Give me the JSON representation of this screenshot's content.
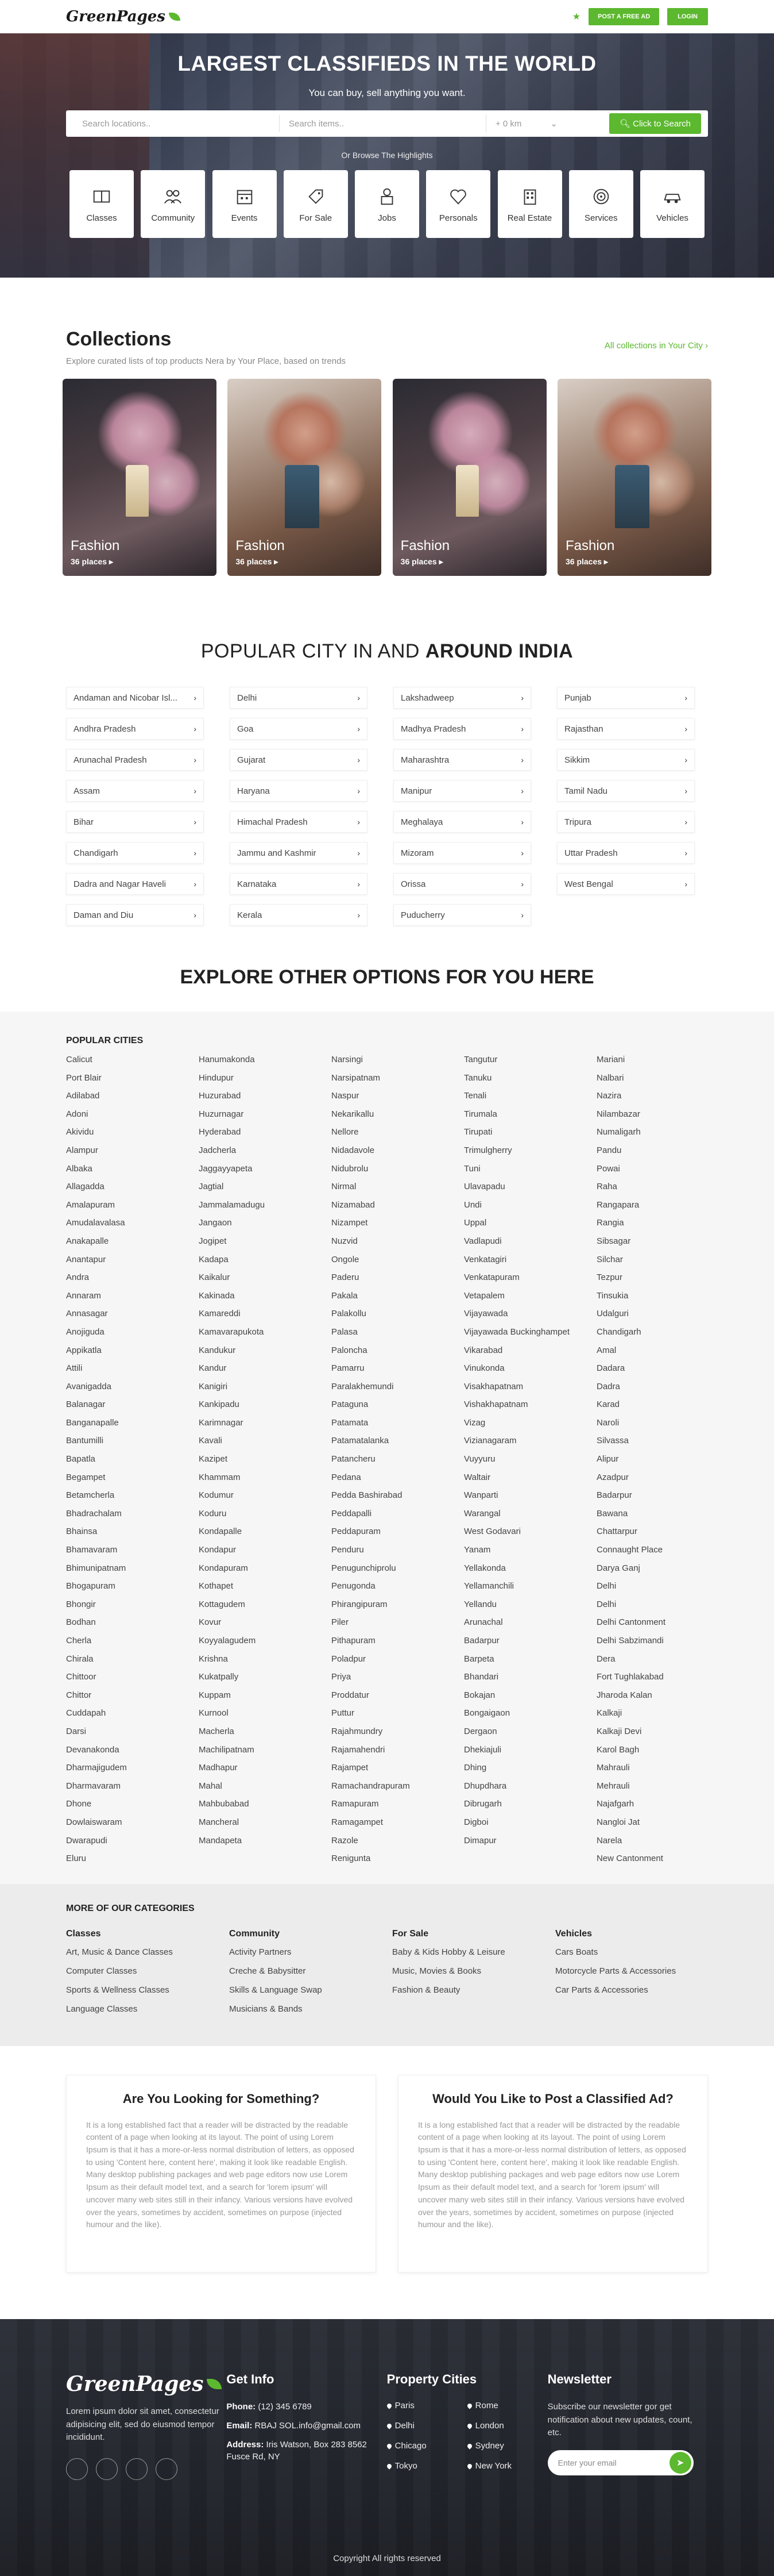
{
  "header": {
    "logo": "GreenPages",
    "post_label": "POST A FREE AD",
    "login_label": "LOGIN"
  },
  "hero": {
    "title": "LARGEST CLASSIFIEDS IN THE WORLD",
    "subtitle": "You can buy, sell anything you want.",
    "location_placeholder": "Search locations..",
    "item_placeholder": "Search items..",
    "km_value": "+ 0 km",
    "search_label": "Click to Search",
    "browse_text": "Or Browse The Highlights",
    "categories": [
      "Classes",
      "Community",
      "Events",
      "For Sale",
      "Jobs",
      "Personals",
      "Real Estate",
      "Services",
      "Vehicles"
    ]
  },
  "collections": {
    "title": "Collections",
    "desc": "Explore curated lists of top products Nera by Your Place, based on trends",
    "all_link": "All collections in Your City",
    "cards": [
      {
        "title": "Fashion",
        "places": "36 places"
      },
      {
        "title": "Fashion",
        "places": "36 places"
      },
      {
        "title": "Fashion",
        "places": "36 places"
      },
      {
        "title": "Fashion",
        "places": "36 places"
      }
    ]
  },
  "popular": {
    "title_a": "POPULAR CITY IN AND",
    "title_b": "AROUND INDIA",
    "states": [
      "Andaman and Nicobar Isl...",
      "Delhi",
      "Lakshadweep",
      "Punjab",
      "Andhra Pradesh",
      "Goa",
      "Madhya Pradesh",
      "Rajasthan",
      "Arunachal Pradesh",
      "Gujarat",
      "Maharashtra",
      "Sikkim",
      "Assam",
      "Haryana",
      "Manipur",
      "Tamil Nadu",
      "Bihar",
      "Himachal Pradesh",
      "Meghalaya",
      "Tripura",
      "Chandigarh",
      "Jammu and Kashmir",
      "Mizoram",
      "Uttar Pradesh",
      "Dadra and Nagar Haveli",
      "Karnataka",
      "Orissa",
      "West Bengal",
      "Daman and Diu",
      "Kerala",
      "Puducherry"
    ]
  },
  "explore": {
    "title": "EXPLORE OTHER OPTIONS FOR YOU HERE",
    "popular_cities_title": "POPULAR CITIES",
    "columns": [
      [
        "Calicut",
        "Port Blair",
        "Adilabad",
        "Adoni",
        "Akividu",
        "Alampur",
        "Albaka",
        "Allagadda",
        "Amalapuram",
        "Amudalavalasa",
        "Anakapalle",
        "Anantapur",
        "Andra",
        "Annaram",
        "Annasagar",
        "Anojiguda",
        "Appikatla",
        "Attili",
        "Avanigadda",
        "Balanagar",
        "Banganapalle",
        "Bantumilli",
        "Bapatla",
        "Begampet",
        "Betamcherla",
        "Bhadrachalam",
        "Bhainsa",
        "Bhamavaram",
        "Bhimunipatnam",
        "Bhogapuram",
        "Bhongir",
        "Bodhan",
        "Cherla",
        "Chirala",
        "Chittoor",
        "Chittor",
        "Cuddapah",
        "Darsi",
        "Devanakonda",
        "Dharmajigudem",
        "Dharmavaram",
        "Dhone",
        "Dowlaiswaram",
        "Dwarapudi",
        "Eluru"
      ],
      [
        "Hanumakonda",
        "Hindupur",
        "Huzurabad",
        "Huzurnagar",
        "Hyderabad",
        "Jadcherla",
        "Jaggayyapeta",
        "Jagtial",
        "Jammalamadugu",
        "Jangaon",
        "Jogipet",
        "Kadapa",
        "Kaikalur",
        "Kakinada",
        "Kamareddi",
        "Kamavarapukota",
        "Kandukur",
        "Kandur",
        "Kanigiri",
        "Kankipadu",
        "Karimnagar",
        "Kavali",
        "Kazipet",
        "Khammam",
        "Kodumur",
        "Koduru",
        "Kondapalle",
        "Kondapur",
        "Kondapuram",
        "Kothapet",
        "Kottagudem",
        "Kovur",
        "Koyyalagudem",
        "Krishna",
        "Kukatpally",
        "Kuppam",
        "Kurnool",
        "Macherla",
        "Machilipatnam",
        "Madhapur",
        "Mahal",
        "Mahbubabad",
        "Mancheral",
        "Mandapeta"
      ],
      [
        "Narsingi",
        "Narsipatnam",
        "Naspur",
        "Nekarikallu",
        "Nellore",
        "Nidadavole",
        "Nidubrolu",
        "Nirmal",
        "Nizamabad",
        "Nizampet",
        "Nuzvid",
        "Ongole",
        "Paderu",
        "Pakala",
        "Palakollu",
        "Palasa",
        "Paloncha",
        "Pamarru",
        "Paralakhemundi",
        "Pataguna",
        "Patamata",
        "Patamatalanka",
        "Patancheru",
        "Pedana",
        "Pedda Bashirabad",
        "Peddapalli",
        "Peddapuram",
        "Penduru",
        "Penugunchiprolu",
        "Penugonda",
        "Phirangipuram",
        "Piler",
        "Pithapuram",
        "Poladpur",
        "Priya",
        "Proddatur",
        "Puttur",
        "Rajahmundry",
        "Rajamahendri",
        "Rajampet",
        "Ramachandrapuram",
        "Ramapuram",
        "Ramagampet",
        "Razole",
        "Renigunta"
      ],
      [
        "Tangutur",
        "Tanuku",
        "Tenali",
        "Tirumala",
        "Tirupati",
        "Trimulgherry",
        "Tuni",
        "Ulavapadu",
        "Undi",
        "Uppal",
        "Vadlapudi",
        "Venkatagiri",
        "Venkatapuram",
        "Vetapalem",
        "Vijayawada",
        "Vijayawada Buckinghampet",
        "Vikarabad",
        "Vinukonda",
        "Visakhapatnam",
        "Vishakhapatnam",
        "Vizag",
        "Vizianagaram",
        "Vuyyuru",
        "Waltair",
        "Wanparti",
        "Warangal",
        "West Godavari",
        "Yanam",
        "Yellakonda",
        "Yellamanchili",
        "Yellandu",
        "Arunachal",
        "Badarpur",
        "Barpeta",
        "Bhandari",
        "Bokajan",
        "Bongaigaon",
        "Dergaon",
        "Dhekiajuli",
        "Dhing",
        "Dhupdhara",
        "Dibrugarh",
        "Digboi",
        "Dimapur"
      ],
      [
        "Mariani",
        "Nalbari",
        "Nazira",
        "Nilambazar",
        "Numaligarh",
        "Pandu",
        "Powai",
        "Raha",
        "Rangapara",
        "Rangia",
        "Sibsagar",
        "Silchar",
        "Tezpur",
        "Tinsukia",
        "Udalguri",
        "Chandigarh",
        "Amal",
        "Dadara",
        "Dadra",
        "Karad",
        "Naroli",
        "Silvassa",
        "Alipur",
        "Azadpur",
        "Badarpur",
        "Bawana",
        "Chattarpur",
        "Connaught Place",
        "Darya Ganj",
        "Delhi",
        "Delhi",
        "Delhi Cantonment",
        "Delhi Sabzimandi",
        "Dera",
        "Fort Tughlakabad",
        "Jharoda Kalan",
        "Kalkaji",
        "Kalkaji Devi",
        "Karol Bagh",
        "Mahrauli",
        "Mehrauli",
        "Najafgarh",
        "Nangloi Jat",
        "Narela",
        "New Cantonment"
      ]
    ]
  },
  "more": {
    "title": "MORE OF OUR CATEGORIES",
    "cols": [
      {
        "h": "Classes",
        "items": [
          "Art, Music & Dance Classes",
          "Computer Classes",
          "Sports & Wellness Classes",
          "Language Classes"
        ]
      },
      {
        "h": "Community",
        "items": [
          "Activity Partners",
          "Creche & Babysitter",
          "Skills & Language Swap",
          "Musicians & Bands"
        ]
      },
      {
        "h": "For Sale",
        "items": [
          "Baby & Kids Hobby & Leisure",
          "Music, Movies & Books",
          "Fashion & Beauty"
        ]
      },
      {
        "h": "Vehicles",
        "items": [
          "Cars Boats",
          "Motorcycle Parts & Accessories",
          "Car Parts & Accessories"
        ]
      }
    ]
  },
  "looking": {
    "box1_title": "Are You Looking for Something?",
    "box2_title": "Would You Like to Post a Classified Ad?",
    "body": "It is a long established fact that a reader will be distracted by the readable content of a page when looking at its layout. The point of using Lorem Ipsum is that it has a more-or-less normal distribution of letters, as opposed to using 'Content here, content here', making it look like readable English. Many desktop publishing packages and web page editors now use Lorem Ipsum as their default model text, and a search for 'lorem ipsum' will uncover many web sites still in their infancy. Various versions have evolved over the years, sometimes by accident, sometimes on purpose (injected humour and the like)."
  },
  "footer": {
    "logo": "GreenPages",
    "about": "Lorem ipsum dolor sit amet, consectetur adipisicing elit, sed do eiusmod tempor incididunt.",
    "getinfo_title": "Get Info",
    "phone_label": "Phone:",
    "phone": "(12) 345 6789",
    "email_label": "Email:",
    "email": "RBAJ SOL.info@gmail.com",
    "address_label": "Address:",
    "address": "Iris Watson, Box 283 8562 Fusce Rd, NY",
    "cities_title": "Property Cities",
    "cities": [
      "Paris",
      "Rome",
      "Delhi",
      "London",
      "Chicago",
      "Sydney",
      "Tokyo",
      "New York"
    ],
    "newsletter_title": "Newsletter",
    "newsletter_text": "Subscribe our newsletter gor get notification about new updates, count, etc.",
    "email_placeholder": "Enter your email",
    "copyright": "Copyright All rights reserved"
  },
  "colors": {
    "accent": "#5cb82e"
  }
}
